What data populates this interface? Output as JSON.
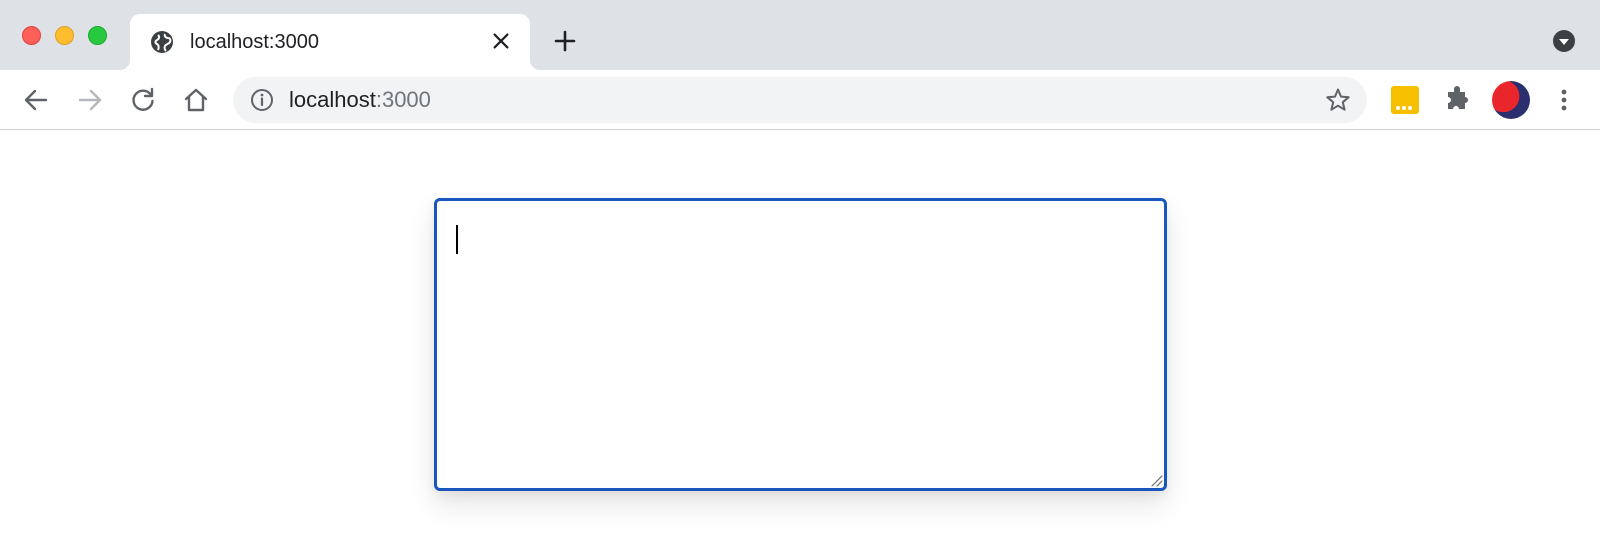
{
  "browser": {
    "tab": {
      "title": "localhost:3000",
      "favicon": "globe-icon"
    },
    "new_tab_icon": "plus-icon",
    "tab_search_icon": "chevron-down-circle-icon",
    "toolbar": {
      "back_icon": "arrow-left-icon",
      "forward_icon": "arrow-right-icon",
      "reload_icon": "reload-icon",
      "home_icon": "home-icon"
    },
    "omnibox": {
      "host": "localhost",
      "port": ":3000",
      "info_icon": "info-icon",
      "bookmark_icon": "star-icon"
    },
    "extensions": [
      {
        "name": "password-manager-extension",
        "color": "#f6c000"
      },
      {
        "name": "extensions-puzzle-icon"
      }
    ],
    "menu_icon": "kebab-menu-icon"
  },
  "page": {
    "textarea": {
      "value": "",
      "placeholder": "",
      "focused": true,
      "border_color": "#1a56be"
    }
  },
  "colors": {
    "tabstrip_bg": "#dee1e6",
    "omnibox_bg": "#f1f3f4",
    "focus_ring": "#1a56be"
  }
}
